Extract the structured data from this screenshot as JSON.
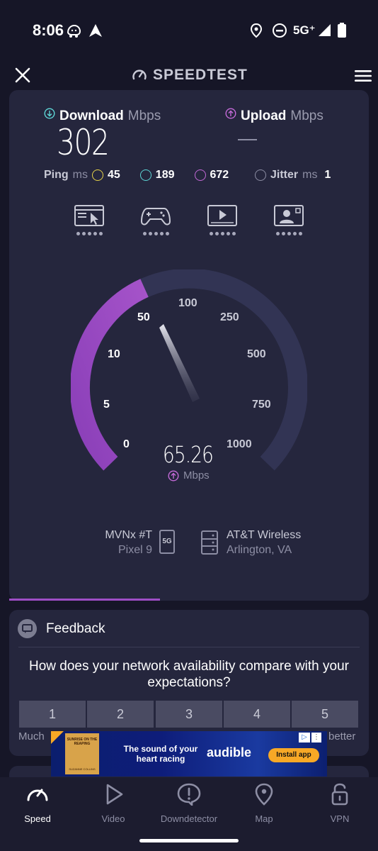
{
  "status_bar": {
    "time": "8:06",
    "network": "5G⁺",
    "icons": [
      "waze-icon",
      "maps-nav-icon",
      "location-icon",
      "dnd-icon",
      "signal-icon",
      "battery-icon"
    ]
  },
  "header": {
    "title": "SPEEDTEST",
    "close_icon": "close-icon",
    "menu_icon": "hamburger-menu-icon"
  },
  "results": {
    "download": {
      "label": "Download",
      "unit": "Mbps",
      "value": "302"
    },
    "upload": {
      "label": "Upload",
      "unit": "Mbps",
      "value": "—"
    },
    "ping": {
      "label": "Ping",
      "unit": "ms",
      "idle": "45",
      "download": "189",
      "upload": "672"
    },
    "jitter": {
      "label": "Jitter",
      "unit": "ms",
      "value": "1"
    }
  },
  "use_cases": [
    {
      "name": "browsing",
      "icon": "browser-cursor-icon",
      "rating": 5
    },
    {
      "name": "gaming",
      "icon": "gamepad-icon",
      "rating": 5
    },
    {
      "name": "video",
      "icon": "video-player-icon",
      "rating": 5
    },
    {
      "name": "video-call",
      "icon": "video-call-icon",
      "rating": 5
    }
  ],
  "gauge": {
    "ticks": [
      "0",
      "5",
      "10",
      "50",
      "100",
      "250",
      "500",
      "750",
      "1000"
    ],
    "current_value": "65.26",
    "unit": "Mbps",
    "phase": "upload"
  },
  "device": {
    "carrier": "MVNx #T",
    "model": "Pixel 9",
    "network_badge": "5G"
  },
  "server": {
    "isp": "AT&T Wireless",
    "location": "Arlington, VA"
  },
  "test_progress": 0.42,
  "feedback": {
    "title": "Feedback",
    "question": "How does your network availability compare with your expectations?",
    "ratings": [
      "1",
      "2",
      "3",
      "4",
      "5"
    ],
    "low_label": "Much",
    "high_label": "better"
  },
  "ad": {
    "book_title": "SUNRISE ON THE REAPING",
    "book_author": "SUZANNE COLLINS",
    "headline": "The sound of your heart racing",
    "brand": "audible",
    "cta": "Install app"
  },
  "bottom_nav": {
    "items": [
      {
        "label": "Speed",
        "icon": "speedometer-icon",
        "active": true
      },
      {
        "label": "Video",
        "icon": "play-icon",
        "active": false
      },
      {
        "label": "Downdetector",
        "icon": "alert-icon",
        "active": false
      },
      {
        "label": "Map",
        "icon": "map-pin-icon",
        "active": false
      },
      {
        "label": "VPN",
        "icon": "lock-open-icon",
        "active": false
      }
    ]
  }
}
